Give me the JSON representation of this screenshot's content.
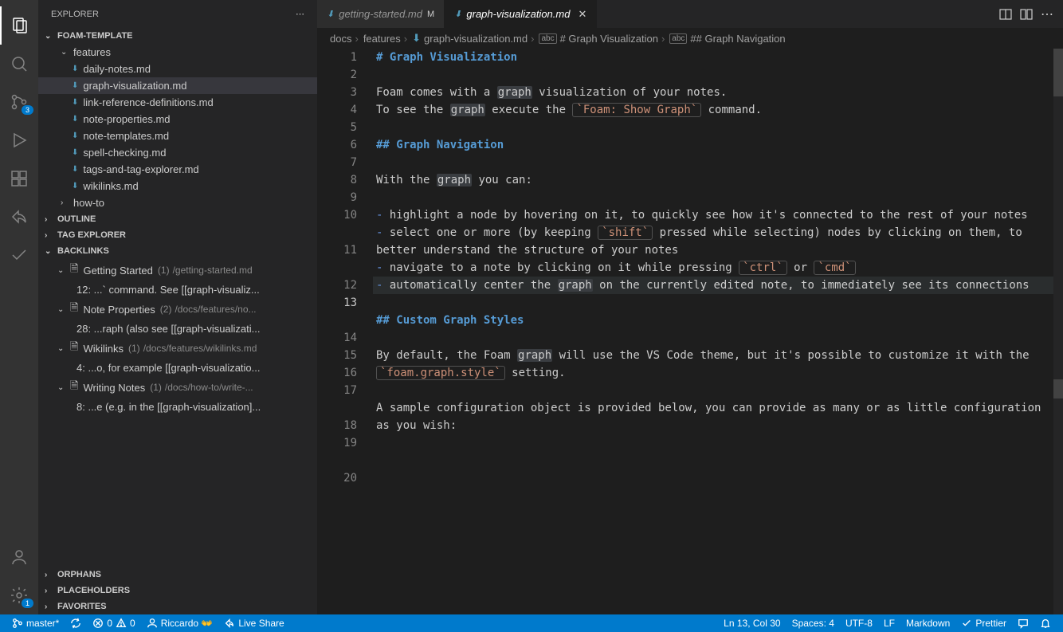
{
  "sidebar": {
    "title": "EXPLORER",
    "sections": {
      "foam": "FOAM-TEMPLATE",
      "outline": "OUTLINE",
      "tagexp": "TAG EXPLORER",
      "backlinks": "BACKLINKS",
      "orphans": "ORPHANS",
      "placeholders": "PLACEHOLDERS",
      "favorites": "FAVORITES"
    },
    "folders": {
      "features": "features",
      "howto": "how-to"
    },
    "files": [
      "daily-notes.md",
      "graph-visualization.md",
      "link-reference-definitions.md",
      "note-properties.md",
      "note-templates.md",
      "spell-checking.md",
      "tags-and-tag-explorer.md",
      "wikilinks.md"
    ],
    "backlinks": [
      {
        "title": "Getting Started",
        "count": "(1)",
        "path": "/getting-started.md",
        "line": "12: ...` command. See [[graph-visualiz..."
      },
      {
        "title": "Note Properties",
        "count": "(2)",
        "path": "/docs/features/no...",
        "line": "28: ...raph (also see [[graph-visualizati..."
      },
      {
        "title": "Wikilinks",
        "count": "(1)",
        "path": "/docs/features/wikilinks.md",
        "line": "4: ...o, for example [[graph-visualizatio..."
      },
      {
        "title": "Writing Notes",
        "count": "(1)",
        "path": "/docs/how-to/write-...",
        "line": "8: ...e (e.g. in the [[graph-visualization]..."
      }
    ]
  },
  "activity": {
    "scm_badge": "3",
    "settings_badge": "1"
  },
  "tabs": [
    {
      "label": "getting-started.md",
      "modified": "M",
      "active": false
    },
    {
      "label": "graph-visualization.md",
      "modified": "",
      "active": true
    }
  ],
  "breadcrumbs": {
    "parts": [
      "docs",
      "features",
      "graph-visualization.md",
      "# Graph Visualization",
      "## Graph Navigation"
    ]
  },
  "editor": {
    "lines": {
      "l1": "# Graph Visualization",
      "l3a": "Foam comes with a ",
      "l3b": "graph",
      "l3c": " visualization of your notes.",
      "l4a": "To see the ",
      "l4b": "graph",
      "l4c": " execute the ",
      "l4d": "`Foam: Show Graph`",
      "l4e": " command.",
      "l6": "## Graph Navigation",
      "l8a": "With the ",
      "l8b": "graph",
      "l8c": " you can:",
      "l10a": "- ",
      "l10b": "highlight a node by hovering on it, to quickly see how it's connected to the rest of your notes",
      "l11a": "- ",
      "l11b": "select one or more (by keeping ",
      "l11c": "`shift`",
      "l11d": " pressed while selecting) nodes by clicking on them, to better understand the structure of your notes",
      "l12a": "- ",
      "l12b": "navigate to a note by clicking on it while pressing ",
      "l12c": "`ctrl`",
      "l12d": " or ",
      "l12e": "`cmd`",
      "l13a": "- ",
      "l13b": "automatically center the ",
      "l13c": "graph",
      "l13d": " on the currently edited note, to immediately see its connections",
      "l15": "## Custom Graph Styles",
      "l17a": "By default, the Foam ",
      "l17b": "graph",
      "l17c": " will use the VS Code theme, but it's possible to customize it with the ",
      "l17d": "`foam.graph.style`",
      "l17e": " setting.",
      "l19": "A sample configuration object is provided below, you can provide as many or as little configuration as you wish:"
    },
    "gutters": [
      "1",
      "2",
      "3",
      "4",
      "5",
      "6",
      "7",
      "8",
      "9",
      "10",
      "",
      "11",
      "",
      "12",
      "13",
      "",
      "14",
      "15",
      "16",
      "17",
      "",
      "18",
      "19",
      "",
      "20"
    ]
  },
  "statusbar": {
    "branch": "master*",
    "sync": "",
    "errors": "0",
    "warnings": "0",
    "user": "Riccardo 👐",
    "liveshare": "Live Share",
    "position": "Ln 13, Col 30",
    "spaces": "Spaces: 4",
    "encoding": "UTF-8",
    "eol": "LF",
    "lang": "Markdown",
    "prettier": "Prettier"
  }
}
